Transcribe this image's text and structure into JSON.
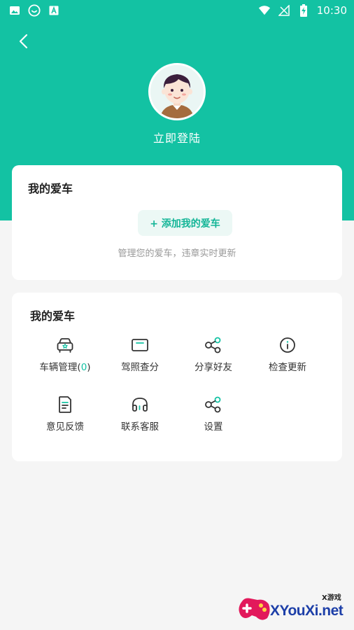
{
  "status_bar": {
    "time": "10:30",
    "icons_left": [
      "image-icon",
      "smiley-icon",
      "font-icon"
    ],
    "icons_right": [
      "wifi-icon",
      "no-signal-icon",
      "battery-charging-icon"
    ]
  },
  "header": {
    "login_label": "立即登陆",
    "accent_color": "#13c2a3"
  },
  "my_car_card": {
    "title": "我的爱车",
    "add_button_label": "+ 添加我的爱车",
    "description": "管理您的爱车，违章实时更新"
  },
  "menu_card": {
    "title": "我的爱车",
    "items": [
      {
        "label": "车辆管理(",
        "count": "0",
        "label_suffix": ")",
        "icon": "car-icon"
      },
      {
        "label": "驾照查分",
        "icon": "license-card-icon"
      },
      {
        "label": "分享好友",
        "icon": "share-icon"
      },
      {
        "label": "检查更新",
        "icon": "info-icon"
      },
      {
        "label": "意见反馈",
        "icon": "feedback-document-icon"
      },
      {
        "label": "联系客服",
        "icon": "headset-icon"
      },
      {
        "label": "设置",
        "icon": "settings-share-icon"
      }
    ]
  },
  "watermark": {
    "brand": "XYouXi.net",
    "tag": "X游戏"
  }
}
